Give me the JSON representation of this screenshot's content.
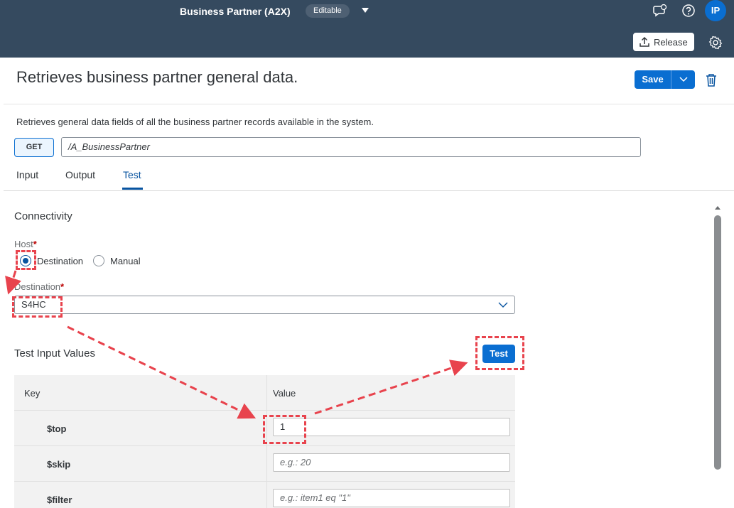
{
  "shell": {
    "title": "Business Partner (A2X)",
    "badge": "Editable",
    "avatar_initials": "IP",
    "release_label": "Release",
    "icons": [
      "feedback-icon",
      "help-icon",
      "settings-icon"
    ]
  },
  "header": {
    "title": "Retrieves business partner general data.",
    "save_label": "Save",
    "description": "Retrieves general data fields of all the business partner records available in the system.",
    "method": "GET",
    "path": "/A_BusinessPartner"
  },
  "tabs": [
    {
      "label": "Input",
      "active": false
    },
    {
      "label": "Output",
      "active": false
    },
    {
      "label": "Test",
      "active": true
    }
  ],
  "connectivity": {
    "section_title": "Connectivity",
    "host_label": "Host",
    "host_options": [
      {
        "label": "Destination",
        "selected": true
      },
      {
        "label": "Manual",
        "selected": false
      }
    ],
    "destination_label": "Destination",
    "destination_value": "S4HC"
  },
  "test_inputs": {
    "section_title": "Test Input Values",
    "test_button": "Test",
    "columns": [
      "Key",
      "Value"
    ],
    "rows": [
      {
        "key": "$top",
        "value": "1",
        "placeholder": ""
      },
      {
        "key": "$skip",
        "value": "",
        "placeholder": "e.g.: 20"
      },
      {
        "key": "$filter",
        "value": "",
        "placeholder": "e.g.: item1 eq \"1\""
      }
    ]
  },
  "colors": {
    "shell_bg": "#354a5f",
    "accent": "#0a6ed1",
    "annotation": "#e8434d"
  }
}
